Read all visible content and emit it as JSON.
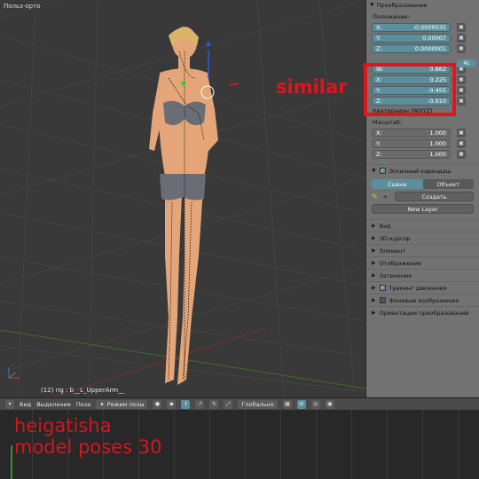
{
  "viewport": {
    "title": "Польз-орто",
    "status": "(12) rig : b__L_UpperArm__"
  },
  "panel": {
    "transform_header": "Преобразование",
    "location_label": "Положение:",
    "location": [
      {
        "axis": "X:",
        "value": "-0.0000035"
      },
      {
        "axis": "Y:",
        "value": "0.00007"
      },
      {
        "axis": "Z:",
        "value": "0.0000001"
      }
    ],
    "rotation_mode_tag": "4L",
    "rotation": [
      {
        "axis": "W:",
        "value": "0.862"
      },
      {
        "axis": "X:",
        "value": "0.225"
      },
      {
        "axis": "Y:",
        "value": "-0.455"
      },
      {
        "axis": "Z:",
        "value": "-0.010"
      }
    ],
    "rotation_mode_label": "Кватернион (WXYZ)",
    "scale_label": "Масштаб:",
    "scale": [
      {
        "axis": "X:",
        "value": "1.000"
      },
      {
        "axis": "Y:",
        "value": "1.000"
      },
      {
        "axis": "Z:",
        "value": "1.000"
      }
    ],
    "grease_header": "Эскизный карандаш",
    "tab_scene": "Сцена",
    "tab_object": "Объект",
    "create_label": "Создать",
    "new_layer": "New Layer",
    "sections": [
      "Вид",
      "3D-курсор",
      "Элемент",
      "Отображение",
      "Затенение"
    ],
    "motion_tracking": "Трекинг движения",
    "background_images": "Фоновые изображения",
    "transform_orientations": "Ориентации преобразований"
  },
  "toolbar": {
    "view": "Вид",
    "select": "Выделение",
    "pose": "Поза",
    "mode": "Режим позы",
    "pivot": "Глобально"
  },
  "overlay": {
    "similar": "similar",
    "watermark_line1": "heigatisha",
    "watermark_line2": "model poses 30"
  },
  "colors": {
    "highlight_red": "#e1141c",
    "accent_blue": "#5d8e9b"
  }
}
